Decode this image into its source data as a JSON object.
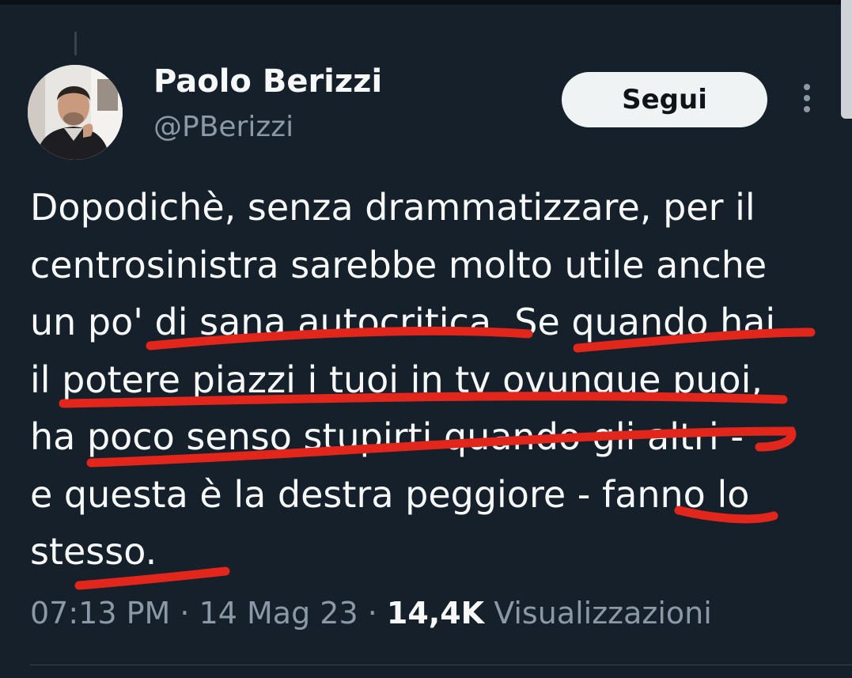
{
  "tweet": {
    "author_name": "Paolo Berizzi",
    "author_handle": "@PBerizzi",
    "follow_label": "Segui",
    "text": "Dopodichè, senza drammatizzare, per il\ncentrosinistra sarebbe molto utile anche\nun po' di sana autocritica. Se quando hai\nil potere piazzi i tuoi in tv ovunque puoi,\nha poco senso stupirti quando gli altri -\ne questa è la destra peggiore - fanno lo\nstesso.",
    "time": "07:13 PM",
    "date": "14 Mag 23",
    "separator": "·",
    "views_count": "14,4K",
    "views_label": "Visualizzazioni"
  },
  "icons": {
    "more": "more-vertical-icon",
    "avatar": "profile-photo"
  },
  "colors": {
    "background": "#15202b",
    "text": "#f7f9f9",
    "secondary_text": "#8b98a5",
    "follow_button_bg": "#eff3f4",
    "annotation_red": "#e3261c"
  }
}
